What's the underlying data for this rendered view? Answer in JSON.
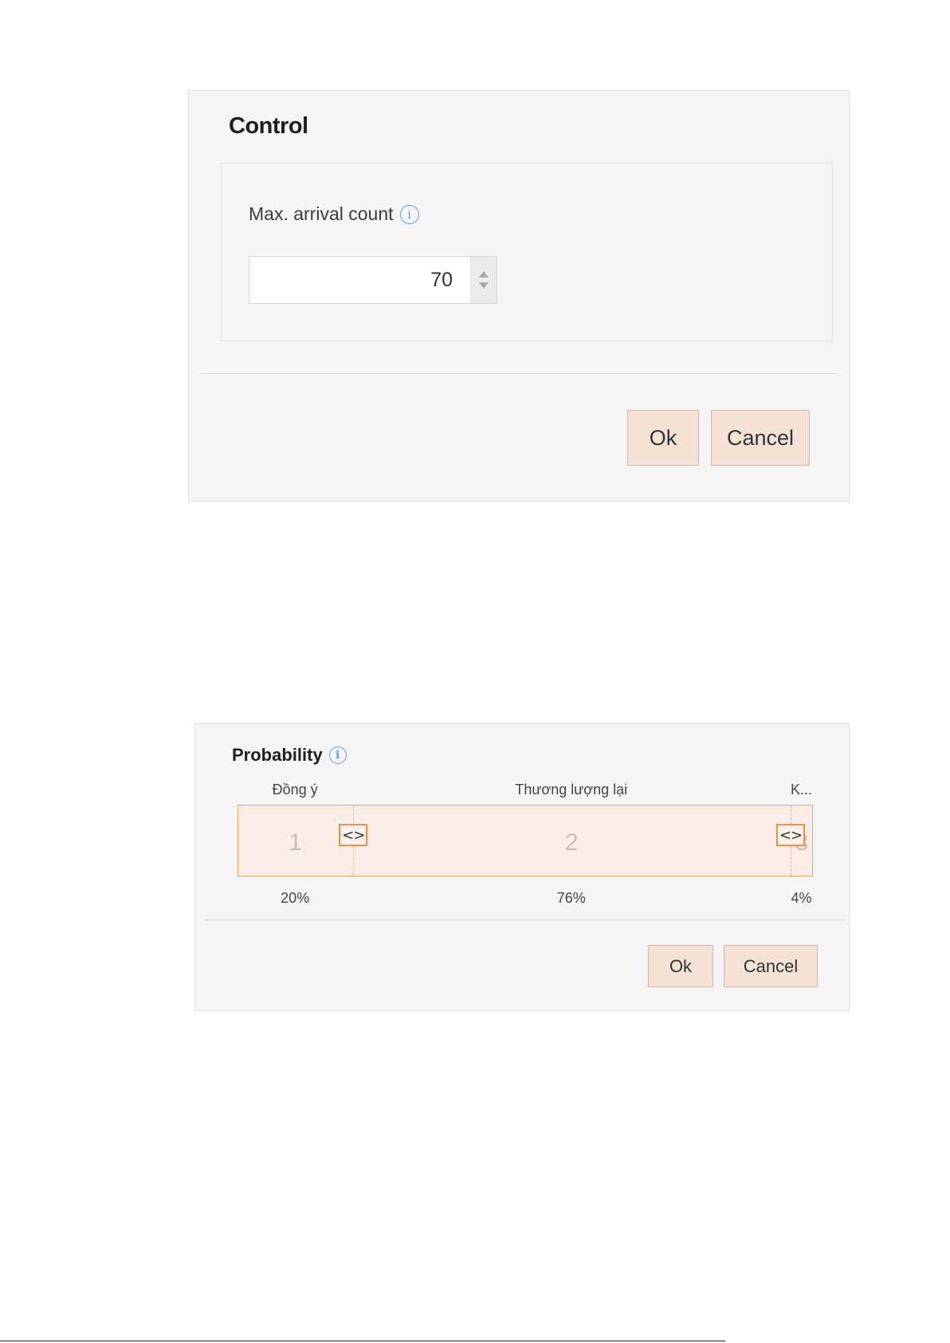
{
  "control_dialog": {
    "title": "Control",
    "field_label": "Max. arrival count",
    "info_icon": "info-icon",
    "value": "70",
    "ok_label": "Ok",
    "cancel_label": "Cancel"
  },
  "probability_dialog": {
    "title": "Probability",
    "info_icon": "info-icon",
    "segments": [
      {
        "label": "Đồng ý",
        "number": "1",
        "percent": "20%",
        "fraction": 0.2
      },
      {
        "label": "Thương lượng lại",
        "number": "2",
        "percent": "76%",
        "fraction": 0.76
      },
      {
        "label": "K...",
        "number": "3",
        "percent": "4%",
        "fraction": 0.04
      }
    ],
    "handle_glyph": "<>",
    "ok_label": "Ok",
    "cancel_label": "Cancel"
  },
  "colors": {
    "button_bg": "#f4e2d6",
    "button_border": "#d9b8a3",
    "segment_border": "#e8a878",
    "handle_border": "#e8924e",
    "info_blue": "#5aa4d8"
  }
}
